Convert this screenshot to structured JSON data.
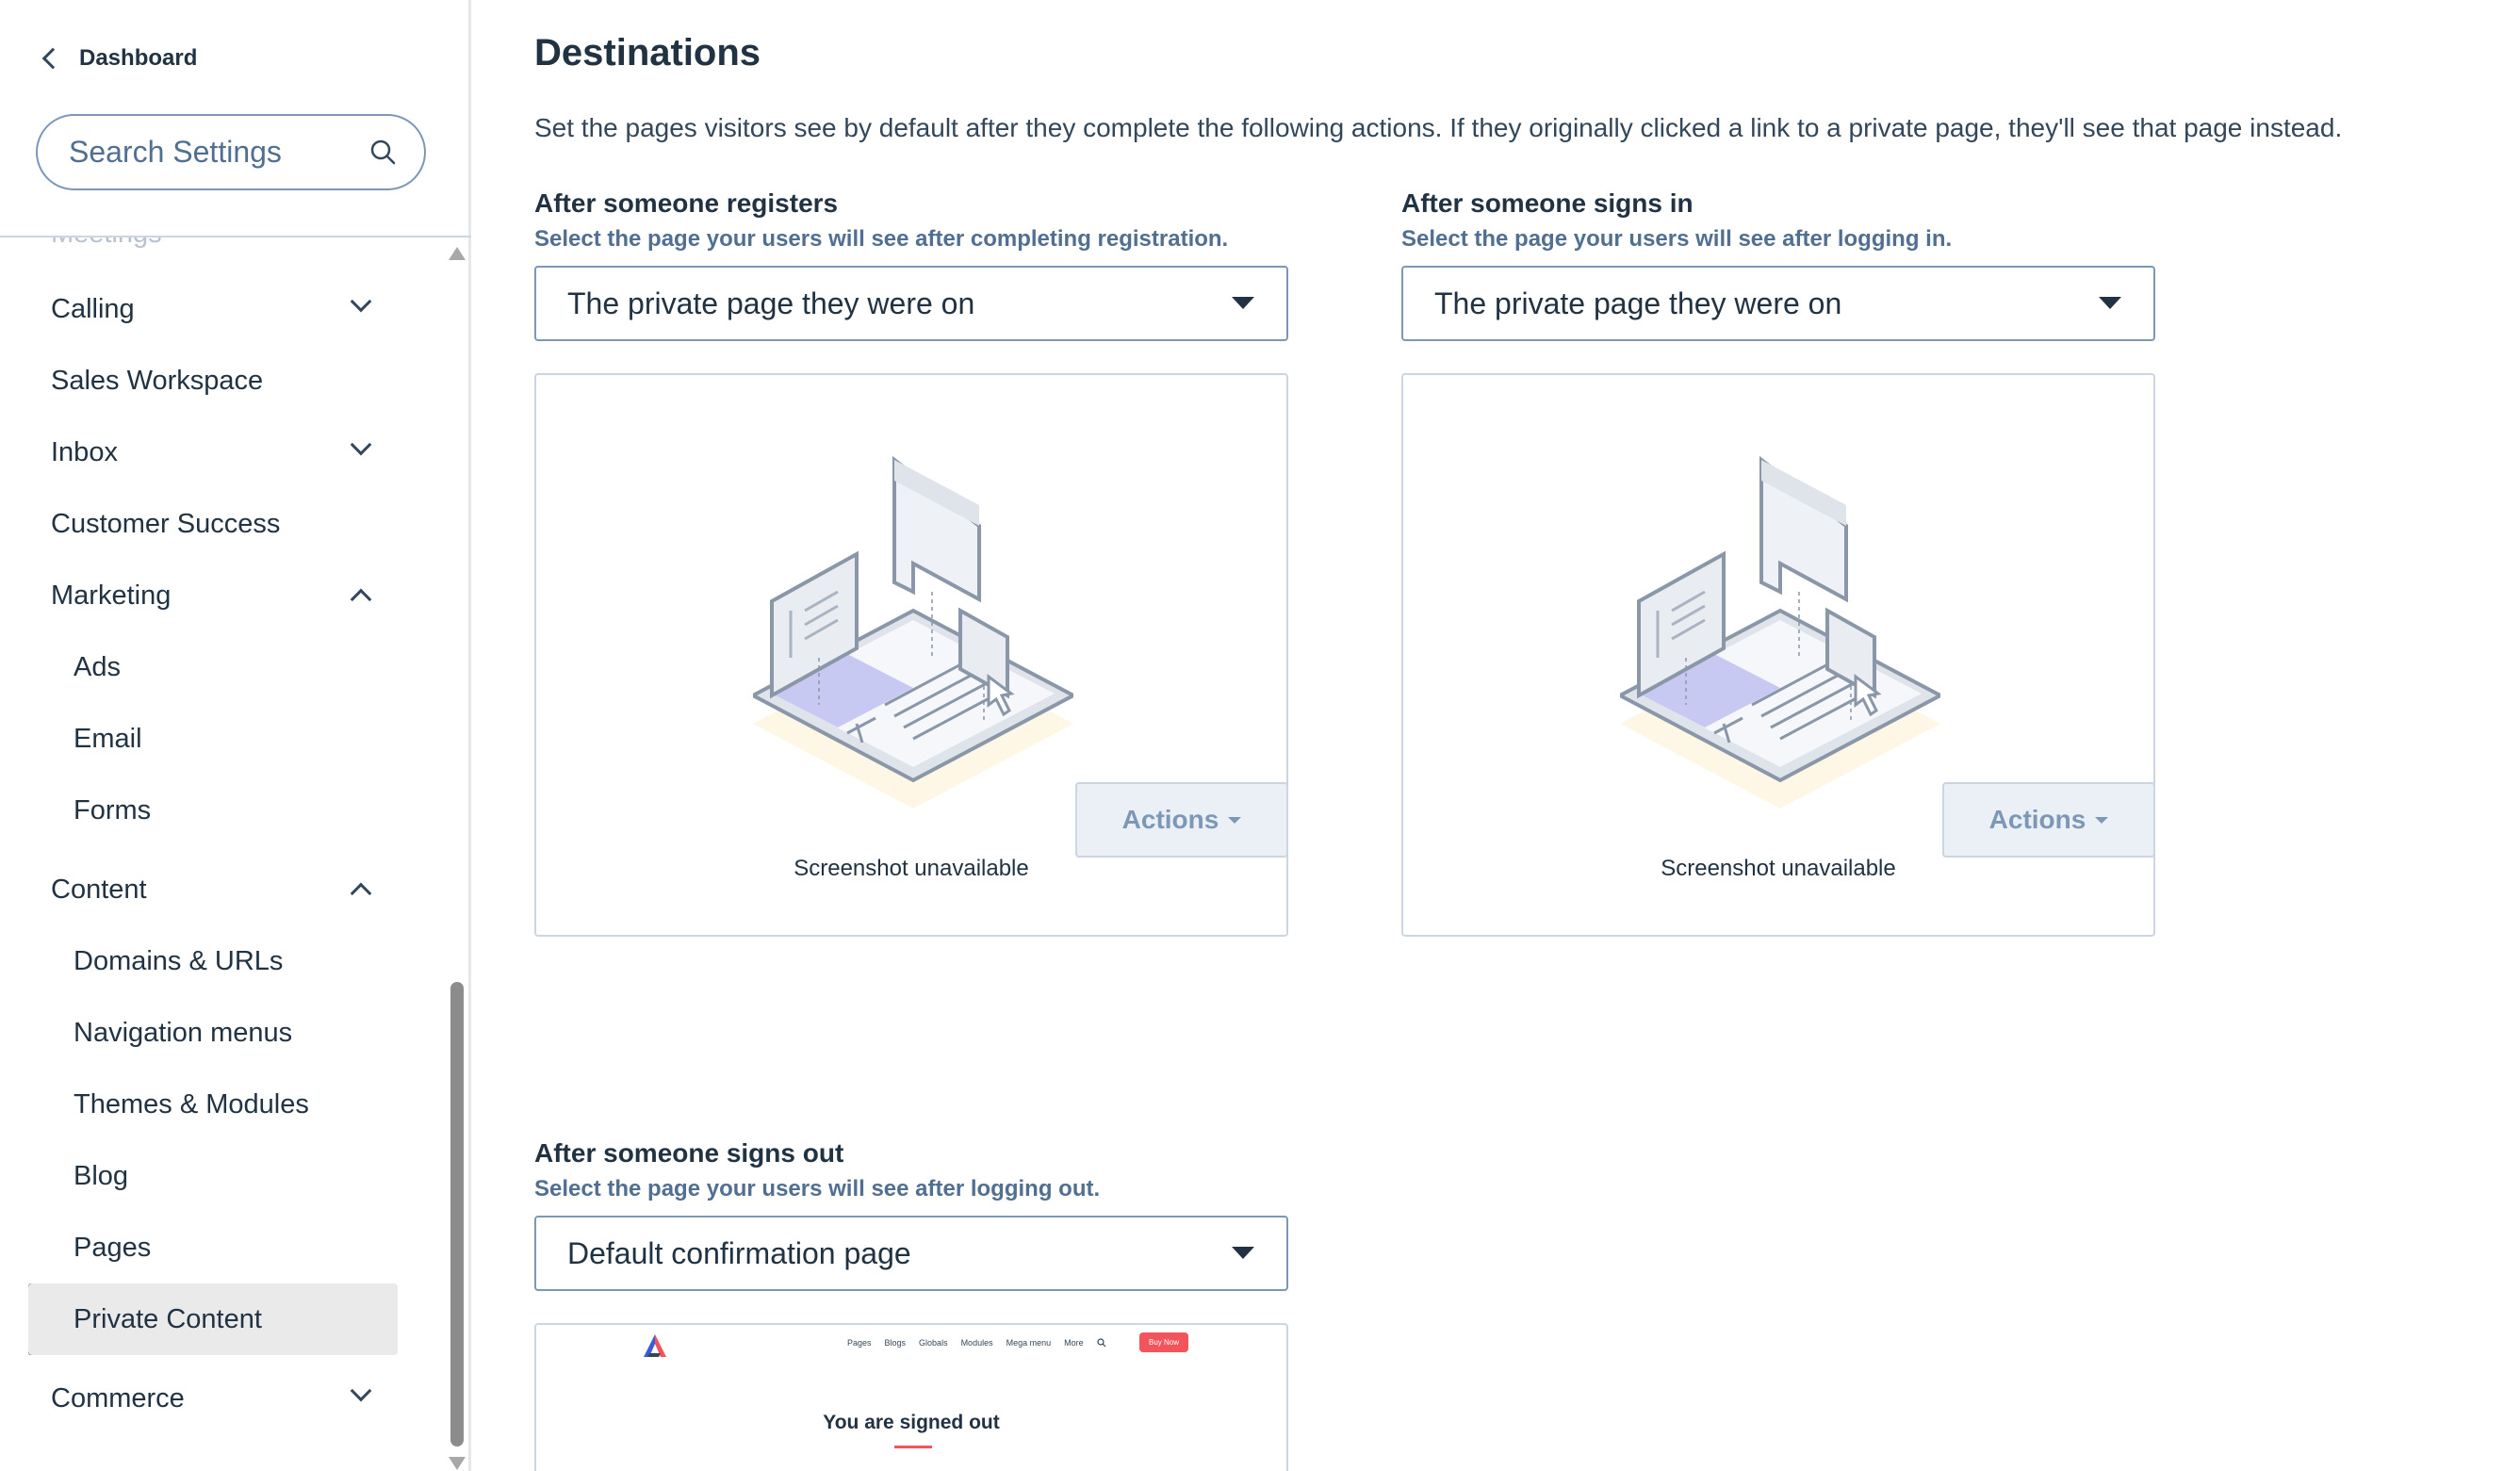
{
  "sidebar": {
    "back_label": "Dashboard",
    "search_placeholder": "Search Settings",
    "faded_item": "Meetings",
    "items": [
      {
        "label": "Calling"
      },
      {
        "label": "Sales Workspace"
      },
      {
        "label": "Inbox"
      },
      {
        "label": "Customer Success"
      },
      {
        "label": "Marketing"
      },
      {
        "label": "Ads"
      },
      {
        "label": "Email"
      },
      {
        "label": "Forms"
      },
      {
        "label": "Content"
      },
      {
        "label": "Domains & URLs"
      },
      {
        "label": "Navigation menus"
      },
      {
        "label": "Themes & Modules"
      },
      {
        "label": "Blog"
      },
      {
        "label": "Pages"
      },
      {
        "label": "Private Content"
      },
      {
        "label": "Commerce"
      }
    ]
  },
  "main": {
    "title": "Destinations",
    "description": "Set the pages visitors see by default after they complete the following actions. If they originally clicked a link to a private page, they'll see that page instead.",
    "register": {
      "heading": "After someone registers",
      "help": "Select the page your users will see after completing registration.",
      "selected": "The private page they were on",
      "caption": "Screenshot unavailable",
      "actions_label": "Actions"
    },
    "signin": {
      "heading": "After someone signs in",
      "help": "Select the page your users will see after logging in.",
      "selected": "The private page they were on",
      "caption": "Screenshot unavailable",
      "actions_label": "Actions"
    },
    "signout": {
      "heading": "After someone signs out",
      "help": "Select the page your users will see after logging out.",
      "selected": "Default confirmation page",
      "preview": {
        "nav": [
          "Pages",
          "Blogs",
          "Globals",
          "Modules",
          "Mega menu",
          "More"
        ],
        "buy_label": "Buy Now",
        "title": "You are signed out"
      }
    }
  },
  "colors": {
    "text_dark": "#213343",
    "text": "#33475b",
    "border": "#cbd6e2",
    "accent": "#f2545b",
    "active_bg": "#eaeaea"
  }
}
